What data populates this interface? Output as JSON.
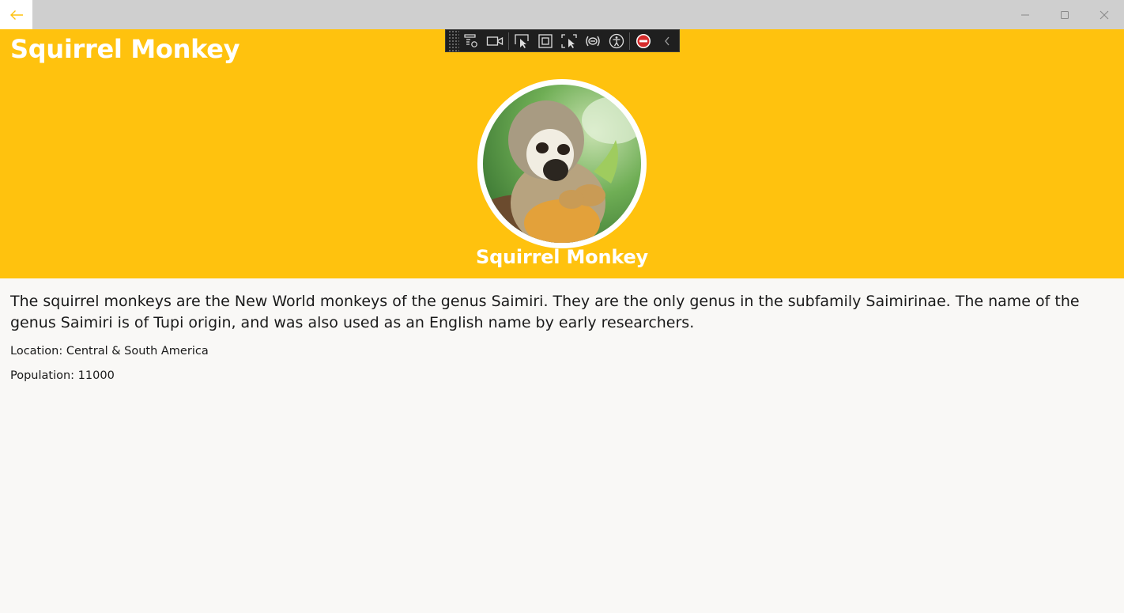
{
  "window": {
    "back_icon": "arrow-left-icon",
    "controls": [
      "minimize-icon",
      "maximize-icon",
      "close-icon"
    ]
  },
  "header": {
    "title": "Squirrel Monkey",
    "image_caption": "Squirrel Monkey",
    "background_color": "#ffc20e"
  },
  "debug_toolbar": {
    "icons": [
      "grip-icon",
      "live-visual-tree-icon",
      "video-icon",
      "select-element-icon",
      "display-layout-adorners-icon",
      "track-focused-element-icon",
      "binding-failures-icon",
      "accessibility-checker-icon",
      "stop-icon",
      "collapse-chevron-icon"
    ]
  },
  "details": {
    "description": "The squirrel monkeys are the New World monkeys of the genus Saimiri. They are the only genus in the subfamily Saimirinae. The name of the genus Saimiri is of Tupi origin, and was also used as an English name by early researchers.",
    "location": "Location: Central & South America",
    "population": "Population: 11000"
  }
}
